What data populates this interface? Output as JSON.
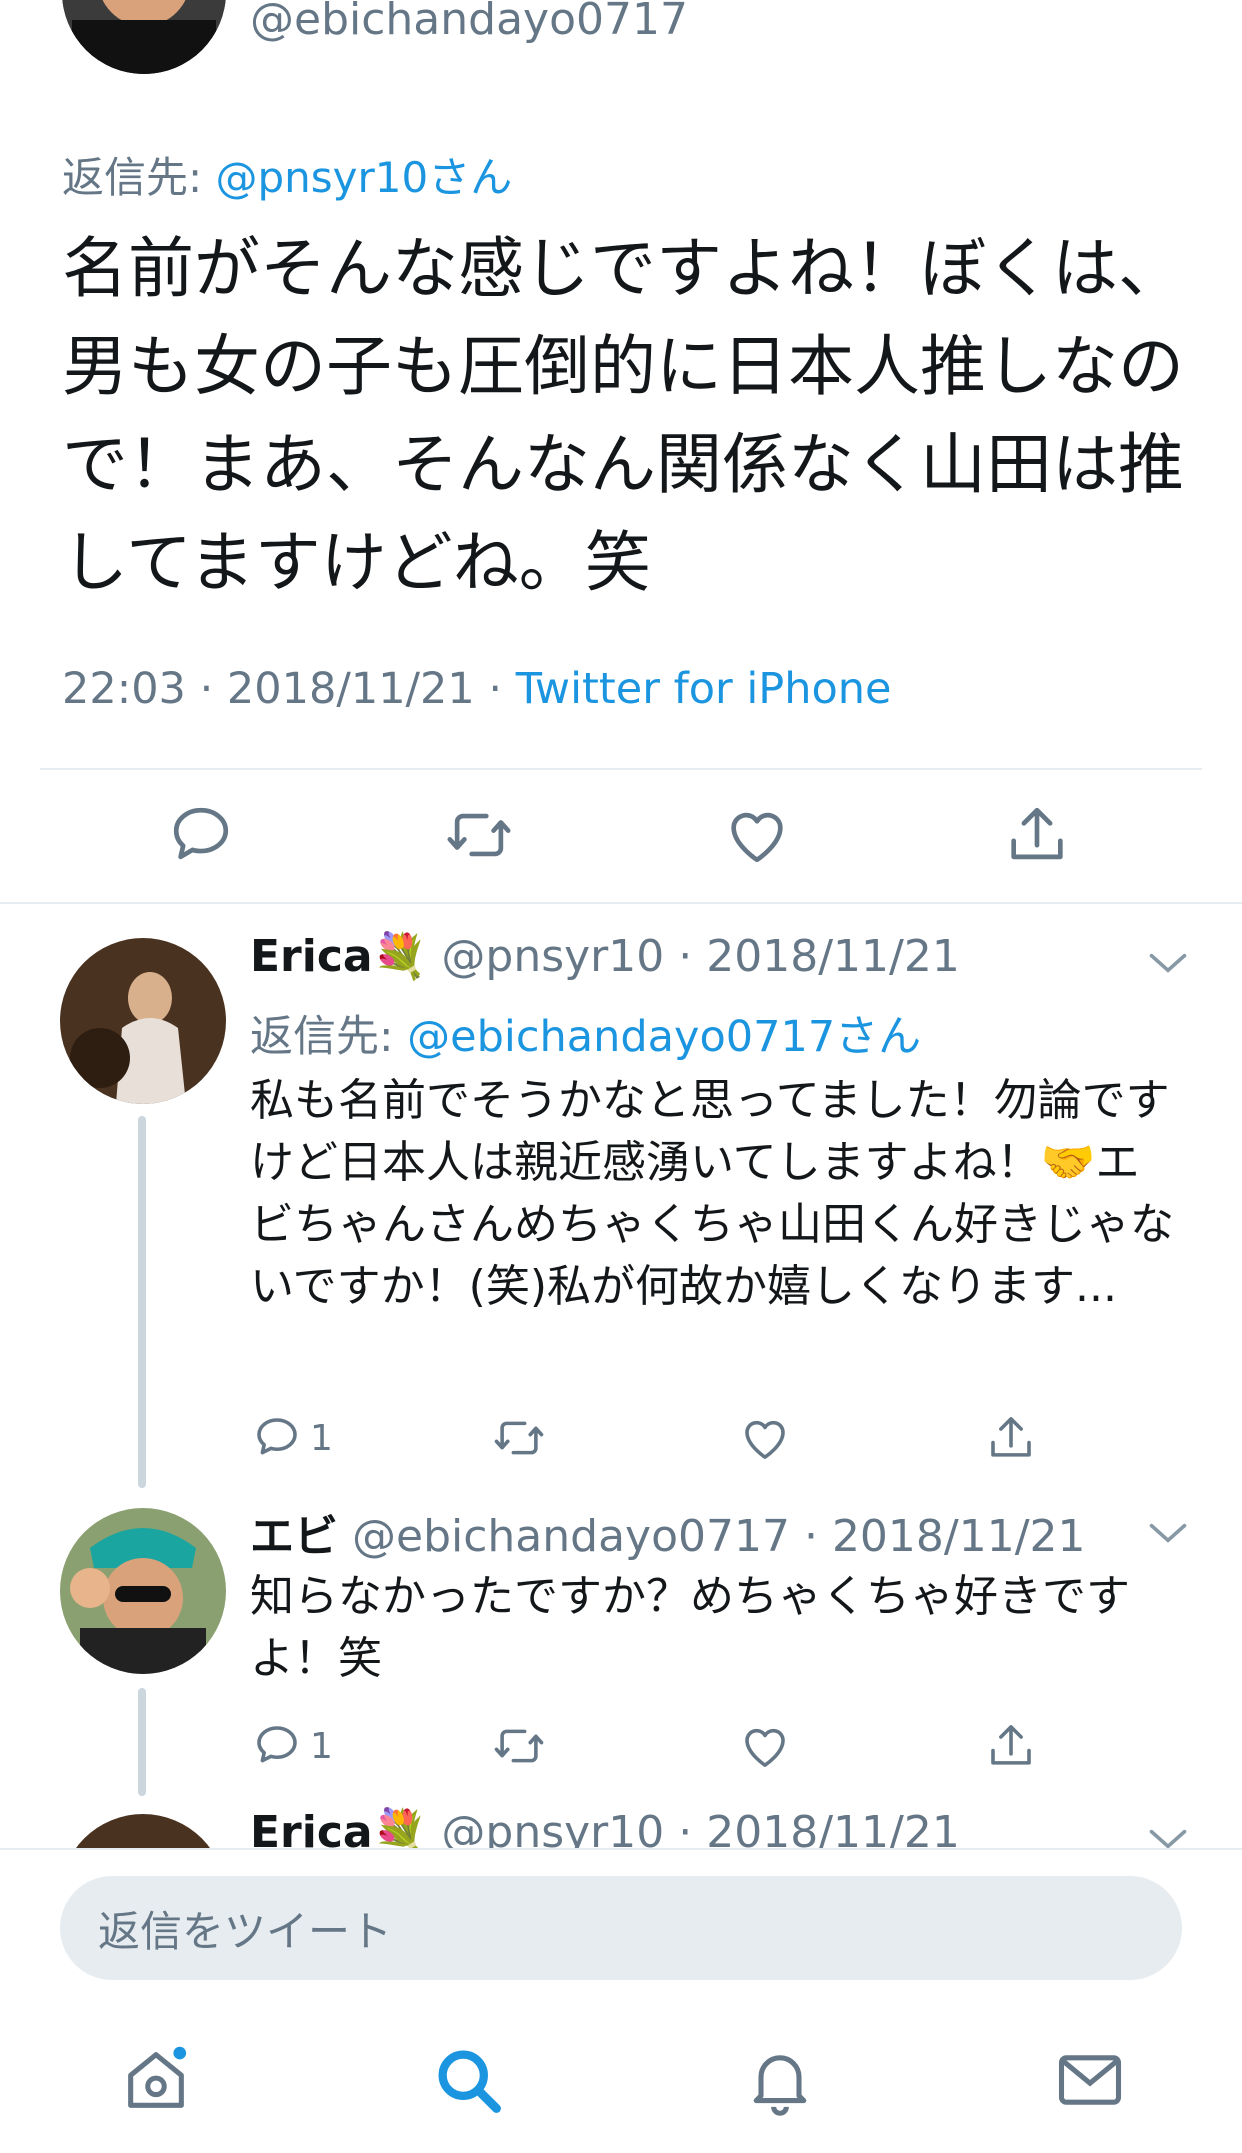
{
  "main_tweet": {
    "handle": "@ebichandayo0717",
    "reply_prefix": "返信先: ",
    "reply_to": "@pnsyr10さん",
    "text": "名前がそんな感じですよね！ぼくは、男も女の子も圧倒的に日本人推しなので！まあ、そんなん関係なく山田は推してますけどね。笑",
    "time": "22:03 · 2018/11/21 · ",
    "source": "Twitter for iPhone"
  },
  "replies": [
    {
      "name": "Erica💐",
      "handle": "@pnsyr10 · 2018/11/21",
      "reply_prefix": "返信先: ",
      "reply_to": "@ebichandayo0717さん",
      "text": "私も名前でそうかなと思ってました！勿論ですけど日本人は親近感湧いてしますよね！🤝エビちゃんさんめちゃくちゃ山田くん好きじゃないですか！(笑)私が何故か嬉しくなります...",
      "reply_count": "1"
    },
    {
      "name": "エビ",
      "handle": "@ebichandayo0717 · 2018/11/21",
      "text": "知らなかったですか？めちゃくちゃ好きですよ！笑",
      "reply_count": "1"
    },
    {
      "name": "Erica💐",
      "handle": "@pnsyr10 · 2018/11/21"
    }
  ],
  "compose": {
    "placeholder": "返信をツイート"
  },
  "colors": {
    "accent": "#1b95e0",
    "secondary_text": "#657786",
    "divider": "#e6ecf0"
  },
  "icons": [
    "reply-icon",
    "retweet-icon",
    "like-icon",
    "share-icon",
    "chevron-down-icon",
    "home-icon",
    "search-icon",
    "notifications-icon",
    "messages-icon"
  ]
}
